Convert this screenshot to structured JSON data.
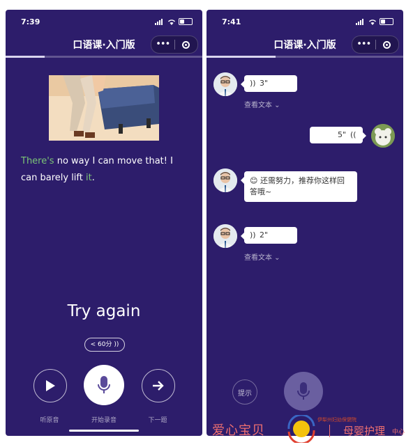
{
  "left_screen": {
    "status": {
      "time": "7:39"
    },
    "nav": {
      "title": "口语课·入门版",
      "more": "•••"
    },
    "progress": 0.2,
    "sentence": {
      "highlight_start": "There's",
      "middle": " no way I can move that! I can barely lift ",
      "highlight_end": "it",
      "end": "."
    },
    "result": "Try again",
    "score": {
      "text": "< 60分 ))"
    },
    "controls": {
      "listen_label": "听原音",
      "record_label": "开始录音",
      "next_label": "下一题"
    }
  },
  "right_screen": {
    "status": {
      "time": "7:41"
    },
    "nav": {
      "title": "口语课·入门版",
      "more": "•••"
    },
    "progress": 0.35,
    "messages": [
      {
        "from": "teacher",
        "type": "voice",
        "duration": "3\"",
        "view_text": "查看文本"
      },
      {
        "from": "user",
        "type": "voice",
        "duration": "5\""
      },
      {
        "from": "teacher",
        "type": "text",
        "text": "😊 还需努力，推荐你这样回答哦~"
      },
      {
        "from": "teacher",
        "type": "voice",
        "duration": "2\"",
        "view_text": "查看文本"
      }
    ],
    "hint_label": "提示"
  },
  "watermark": {
    "brand": "爱心宝贝",
    "small": "伊犁州妇幼保健院",
    "center": "母婴护理",
    "suffix": "中心"
  },
  "colors": {
    "background": "#2d1d6b",
    "highlight": "#7cc576",
    "watermark": "#f07070"
  }
}
